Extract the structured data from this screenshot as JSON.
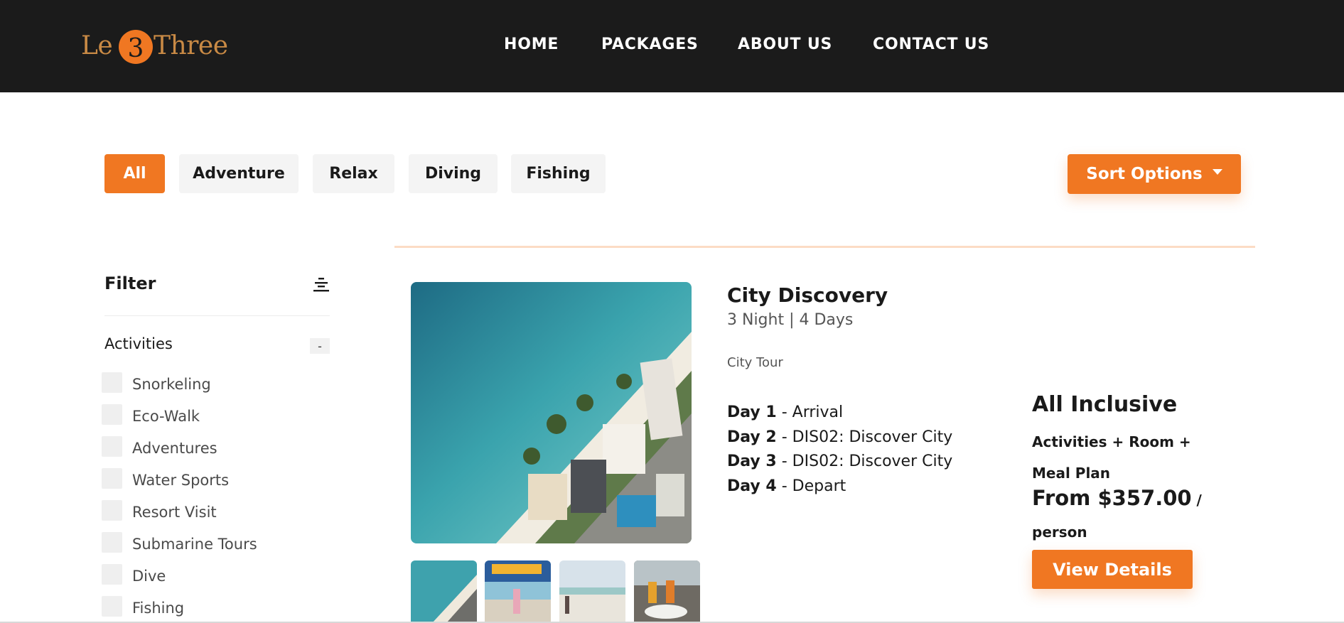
{
  "brand": {
    "logo_left": "Le",
    "logo_right": "Three",
    "logo_number": "3",
    "colors": {
      "accent": "#f07722",
      "header_bg": "#1b1b1b",
      "logo_gold": "#c98a45"
    }
  },
  "nav": {
    "items": [
      {
        "label": "HOME"
      },
      {
        "label": "PACKAGES"
      },
      {
        "label": "ABOUT US"
      },
      {
        "label": "CONTACT US"
      }
    ]
  },
  "categories": {
    "items": [
      {
        "label": "All",
        "active": true
      },
      {
        "label": "Adventure",
        "active": false
      },
      {
        "label": "Relax",
        "active": false
      },
      {
        "label": "Diving",
        "active": false
      },
      {
        "label": "Fishing",
        "active": false
      }
    ],
    "sort_label": "Sort Options"
  },
  "filter": {
    "title": "Filter",
    "section_title": "Activities",
    "collapse_label": "-",
    "activities": [
      {
        "label": "Snorkeling",
        "checked": false
      },
      {
        "label": "Eco-Walk",
        "checked": false
      },
      {
        "label": "Adventures",
        "checked": false
      },
      {
        "label": "Water Sports",
        "checked": false
      },
      {
        "label": "Resort Visit",
        "checked": false
      },
      {
        "label": "Submarine Tours",
        "checked": false
      },
      {
        "label": "Dive",
        "checked": false
      },
      {
        "label": "Fishing",
        "checked": false
      }
    ]
  },
  "package": {
    "title": "City Discovery",
    "duration": "3 Night | 4 Days",
    "type": "City Tour",
    "itinerary": [
      {
        "day": "Day 1",
        "desc": " - Arrival"
      },
      {
        "day": "Day 2",
        "desc": " - DIS02: Discover City"
      },
      {
        "day": "Day 3",
        "desc": " - DIS02: Discover City"
      },
      {
        "day": "Day 4",
        "desc": " - Depart"
      }
    ],
    "inclusion_title": "All Inclusive",
    "inclusion_desc": "Activities + Room + Meal Plan",
    "price": "From $357.00",
    "price_unit": " /",
    "price_per": "person",
    "cta_label": "View Details"
  }
}
